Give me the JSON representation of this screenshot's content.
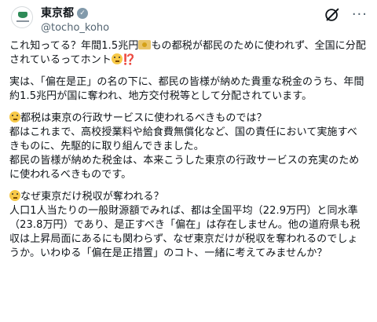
{
  "account": {
    "display_name": "東京都",
    "handle": "@tocho_koho",
    "verified_mark": "✓"
  },
  "icons": {
    "avatar": "tokyo-metropolitan-logo",
    "verified": "verified-badge-icon",
    "grok": "grok-icon",
    "more": "more-icon",
    "money": "money-bag-icon",
    "thinking": "thinking-face-icon",
    "exclaim": "exclamation-question-icon"
  },
  "more_glyph": "···",
  "tweet": {
    "p1_a": "これ知ってる？年間1.5兆円",
    "p1_b": "もの都税が都民のために使われず、全国に分配されているってホント",
    "p1_exclaim": "⁉️",
    "p2": "実は、「偏在是正」の名の下に、都民の皆様が納めた貴重な税金のうち、年間約1.5兆円が国に奪われ、地方交付税等として分配されています。",
    "p3_q": "都税は東京の行政サービスに使われるべきものでは？",
    "p3_l1": "都はこれまで、高校授業料や給食費無償化など、国の責任において実施すべきものに、先駆的に取り組んできました。",
    "p3_l2": "都民の皆様が納めた税金は、本来こうした東京の行政サービスの充実のために使われるべきものです。",
    "p4_q": "なぜ東京だけ税収が奪われる？",
    "p4_body": "人口1人当たりの一般財源額でみれば、都は全国平均（22.9万円）と同水準（23.8万円）であり、是正すべき「偏在」は存在しません。他の道府県も税収は上昇局面にあるにも関わらず、なぜ東京だけが税収を奪われるのでしょうか。いわゆる「偏在是正措置」のコト、一緒に考えてみませんか？"
  }
}
